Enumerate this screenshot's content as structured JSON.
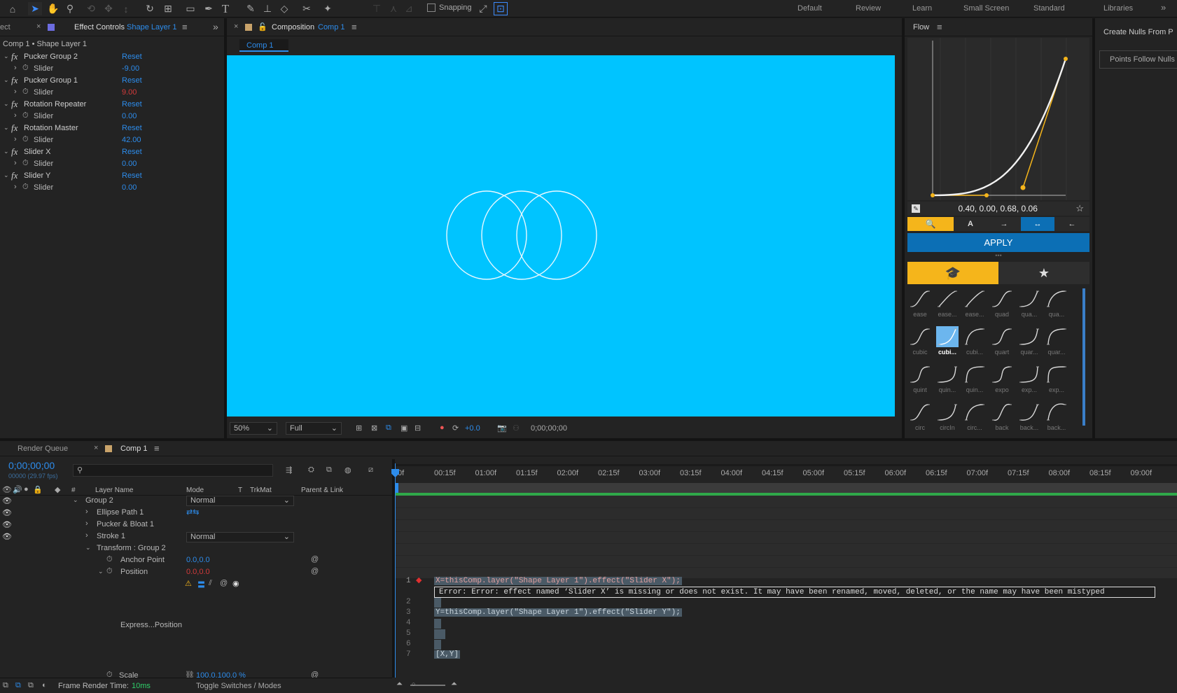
{
  "toolbar": {
    "snapping_label": "Snapping",
    "workspaces": [
      "Default",
      "Review",
      "Learn",
      "Small Screen",
      "Standard",
      "Libraries"
    ]
  },
  "effect_controls": {
    "left_tab_fragment": "ect",
    "tab_label": "Effect Controls",
    "tab_layer": "Shape Layer 1",
    "breadcrumb": "Comp 1 • Shape Layer 1",
    "effects": [
      {
        "name": "Pucker Group 2",
        "reset": "Reset",
        "param": "Slider",
        "value": "-9.00",
        "value_color": "blue"
      },
      {
        "name": "Pucker Group 1",
        "reset": "Reset",
        "param": "Slider",
        "value": "9.00",
        "value_color": "red"
      },
      {
        "name": "Rotation Repeater",
        "reset": "Reset",
        "param": "Slider",
        "value": "0.00",
        "value_color": "blue"
      },
      {
        "name": "Rotation Master",
        "reset": "Reset",
        "param": "Slider",
        "value": "42.00",
        "value_color": "blue"
      },
      {
        "name": "Slider X",
        "reset": "Reset",
        "param": "Slider",
        "value": "0.00",
        "value_color": "blue"
      },
      {
        "name": "Slider Y",
        "reset": "Reset",
        "param": "Slider",
        "value": "0.00",
        "value_color": "blue"
      }
    ]
  },
  "composition": {
    "tab_label": "Composition",
    "tab_comp": "Comp 1",
    "sub_tab": "Comp 1",
    "viewer_bg": "#00c4ff",
    "zoom": "50%",
    "resolution": "Full",
    "exposure": "+0.0",
    "timecode": "0;00;00;00"
  },
  "flow": {
    "title": "Flow",
    "bezier_values": "0.40, 0.00, 0.68, 0.06",
    "apply_label": "APPLY",
    "accent": "#f5b51b",
    "apply_color": "#0c6fb5",
    "presets": [
      [
        "ease",
        "ease...",
        "ease...",
        "quad",
        "qua...",
        "qua..."
      ],
      [
        "cubic",
        "cubi...",
        "cubi...",
        "quart",
        "quar...",
        "quar..."
      ],
      [
        "quint",
        "quin...",
        "quin...",
        "expo",
        "exp...",
        "exp..."
      ],
      [
        "circ",
        "circIn",
        "circ...",
        "back",
        "back...",
        "back..."
      ]
    ],
    "minus": "-",
    "plus": "+"
  },
  "nulls_panel": {
    "title": "Create Nulls From P",
    "button": "Points Follow Nulls"
  },
  "timeline": {
    "render_queue_tab": "Render Queue",
    "comp_tab": "Comp 1",
    "timecode": "0;00;00;00",
    "fps": "00000 (29.97 fps)",
    "search_placeholder": "",
    "columns": {
      "hash": "#",
      "layer_name": "Layer Name",
      "mode": "Mode",
      "t": "T",
      "trkmat": "TrkMat",
      "parent": "Parent & Link"
    },
    "ruler": [
      "0f",
      "00:15f",
      "01:00f",
      "01:15f",
      "02:00f",
      "02:15f",
      "03:00f",
      "03:15f",
      "04:00f",
      "04:15f",
      "05:00f",
      "05:15f",
      "06:00f",
      "06:15f",
      "07:00f",
      "07:15f",
      "08:00f",
      "08:15f",
      "09:00f"
    ],
    "layers": {
      "group2": "Group 2",
      "group2_mode": "Normal",
      "ellipse": "Ellipse Path 1",
      "pucker": "Pucker & Bloat 1",
      "stroke": "Stroke 1",
      "stroke_mode": "Normal",
      "transform": "Transform : Group 2",
      "anchor": "Anchor Point",
      "anchor_value": "0.0,0.0",
      "position": "Position",
      "position_value": "0.0,0.0",
      "expression": "Express...Position",
      "scale": "Scale",
      "scale_value": "100.0,100.0 %"
    },
    "code": {
      "line_numbers": [
        "1",
        "2",
        "3",
        "4",
        "5",
        "6",
        "7"
      ],
      "line1": "X=thisComp.layer(\"Shape Layer 1\").effect(\"Slider X\");",
      "error": "Error:  Error: effect named ‘Slider X’ is missing or does not exist. It may have been renamed, moved, deleted, or the name may have been mistyped",
      "line3": "Y=thisComp.layer(\"Shape Layer 1\").effect(\"Slider Y\");",
      "line7": "[X,Y]"
    },
    "footer": {
      "render_time_label": "Frame Render Time:",
      "render_time_value": "10ms",
      "toggle": "Toggle Switches / Modes"
    }
  }
}
